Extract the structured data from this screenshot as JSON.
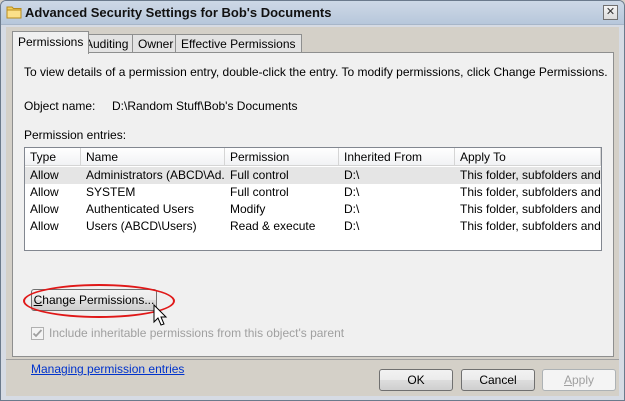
{
  "window": {
    "title": "Advanced Security Settings for Bob's Documents",
    "close_glyph": "✕"
  },
  "tabs": [
    {
      "label": "Permissions",
      "active": true
    },
    {
      "label": "Auditing",
      "active": false
    },
    {
      "label": "Owner",
      "active": false
    },
    {
      "label": "Effective Permissions",
      "active": false
    }
  ],
  "permissions": {
    "info_text": "To view details of a permission entry, double-click the entry. To modify permissions, click Change Permissions.",
    "object_name_label": "Object name:",
    "object_name_value": "D:\\Random Stuff\\Bob's Documents",
    "entries_label": "Permission entries:",
    "columns": [
      "Type",
      "Name",
      "Permission",
      "Inherited From",
      "Apply To"
    ],
    "rows": [
      {
        "type": "Allow",
        "name": "Administrators (ABCD\\Ad...",
        "permission": "Full control",
        "inherited_from": "D:\\",
        "apply_to": "This folder, subfolders and..."
      },
      {
        "type": "Allow",
        "name": "SYSTEM",
        "permission": "Full control",
        "inherited_from": "D:\\",
        "apply_to": "This folder, subfolders and..."
      },
      {
        "type": "Allow",
        "name": "Authenticated Users",
        "permission": "Modify",
        "inherited_from": "D:\\",
        "apply_to": "This folder, subfolders and..."
      },
      {
        "type": "Allow",
        "name": "Users (ABCD\\Users)",
        "permission": "Read & execute",
        "inherited_from": "D:\\",
        "apply_to": "This folder, subfolders and..."
      }
    ],
    "change_button": {
      "label_pre": "C",
      "label_post": "hange Permissions..."
    },
    "inherit_checkbox": {
      "label": "Include inheritable permissions from this object's parent",
      "checked": true,
      "enabled": false
    },
    "link": "Managing permission entries"
  },
  "footer": {
    "ok": "OK",
    "cancel": "Cancel",
    "apply_pre": "A",
    "apply_post": "pply"
  },
  "colors": {
    "highlight": "#e01818",
    "link": "#0033cc"
  }
}
